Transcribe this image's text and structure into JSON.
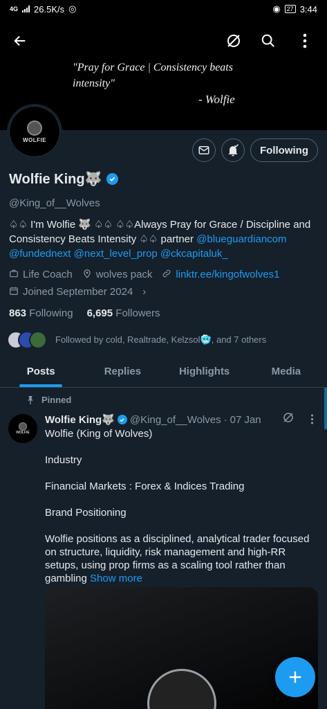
{
  "status_bar": {
    "network": "4G",
    "speed": "26.5K/s",
    "battery": "27",
    "time": "3:44"
  },
  "banner": {
    "quote": "\"Pray for Grace | Consistency beats intensity\"",
    "author": "- Wolfie"
  },
  "avatar": {
    "logo_text": "WOLFIE"
  },
  "actions": {
    "following_label": "Following"
  },
  "profile": {
    "name": "Wolfie King🐺",
    "handle": "@King_of__Wolves",
    "bio_text": "♤♤ I'm Wolfie 🐺 ♤♤ ♤♤Always Pray for Grace / Discipline and Consistency Beats Intensity ♤♤ partner ",
    "bio_links": [
      "@blueguardiancom",
      "@fundednext",
      "@next_level_prop",
      "@ckcapitaluk_"
    ],
    "category": "Life Coach",
    "location": "wolves pack",
    "website": "linktr.ee/kingofwolves1",
    "joined": "Joined September 2024",
    "following_count": "863",
    "following_label": "Following",
    "followers_count": "6,695",
    "followers_label": "Followers",
    "followed_by": "Followed by cold, Realtrade, Kelzsol🥶, and 7 others"
  },
  "tabs": [
    "Posts",
    "Replies",
    "Highlights",
    "Media"
  ],
  "post": {
    "pinned_label": "Pinned",
    "author_name": "Wolfie King🐺",
    "author_handle": "@King_of__Wolves",
    "date": "07 Jan",
    "lines": [
      "Wolfie (King of Wolves)",
      "Industry",
      "Financial Markets : Forex & Indices Trading",
      "Brand Positioning"
    ],
    "last_paragraph": "Wolfie positions as a disciplined, analytical trader focused on structure, liquidity, risk management and high-RR setups, using prop firms as a scaling tool rather than gambling ",
    "show_more": "Show more"
  },
  "colors": {
    "accent": "#1d9bf0",
    "background": "#15202b"
  }
}
